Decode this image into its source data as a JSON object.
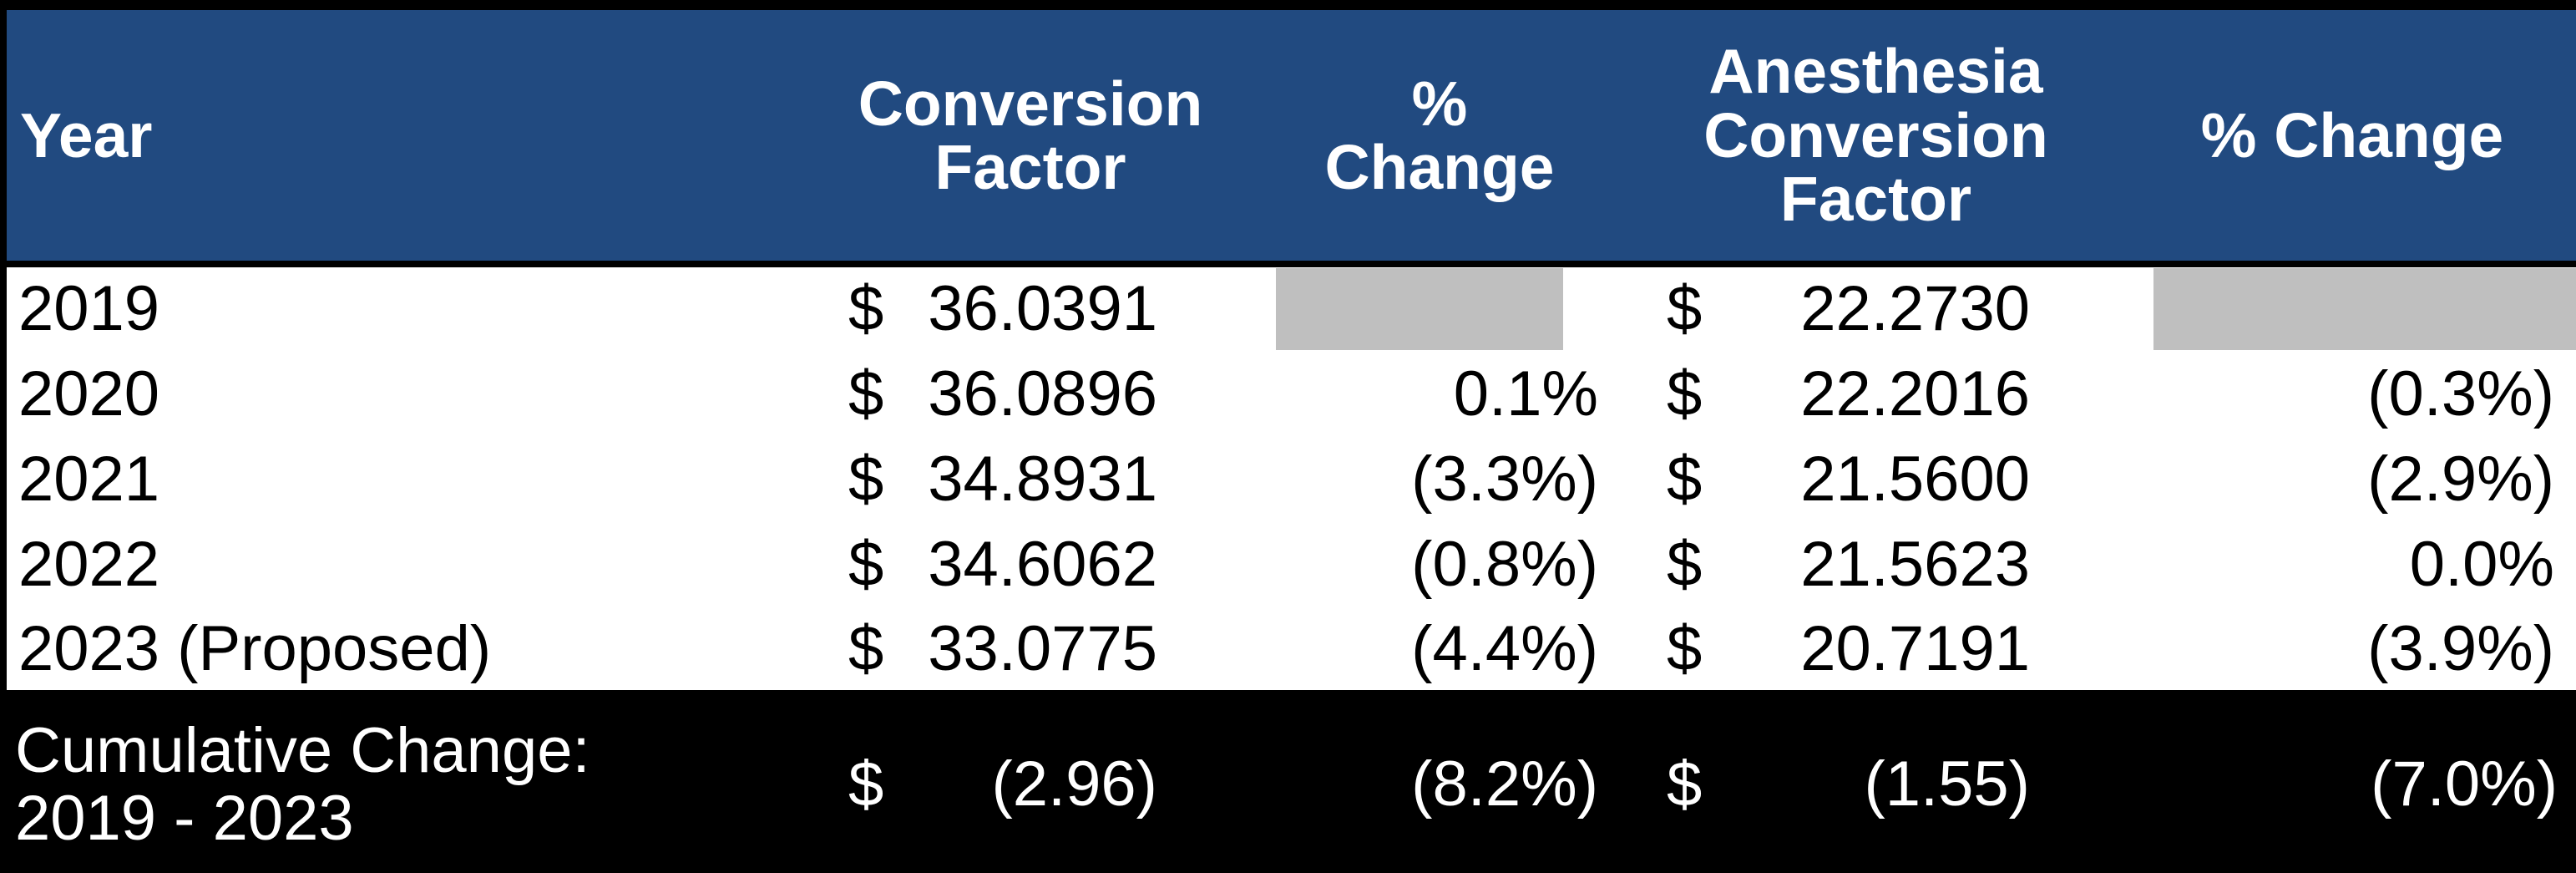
{
  "table": {
    "columns": [
      {
        "key": "year",
        "label": "Year"
      },
      {
        "key": "cf",
        "label": "Conversion Factor"
      },
      {
        "key": "cf_pct",
        "label": "% Change"
      },
      {
        "key": "anes_cf",
        "label": "Anesthesia Conversion Factor"
      },
      {
        "key": "anes_pct",
        "label": "% Change"
      }
    ],
    "header_lines": {
      "year": [
        "Year"
      ],
      "cf": [
        "Conversion",
        "Factor"
      ],
      "cf_pct": [
        "%",
        "Change"
      ],
      "anes_cf": [
        "Anesthesia",
        "Conversion",
        "Factor"
      ],
      "anes_pct": [
        "% Change"
      ]
    },
    "currency_symbol": "$",
    "rows": [
      {
        "year": "2019",
        "cf": "36.0391",
        "cf_pct": "",
        "cf_pct_blank": true,
        "anes_cf": "22.2730",
        "anes_pct": "",
        "anes_pct_blank": true
      },
      {
        "year": "2020",
        "cf": "36.0896",
        "cf_pct": "0.1%",
        "cf_pct_blank": false,
        "anes_cf": "22.2016",
        "anes_pct": "(0.3%)",
        "anes_pct_blank": false
      },
      {
        "year": "2021",
        "cf": "34.8931",
        "cf_pct": "(3.3%)",
        "cf_pct_blank": false,
        "anes_cf": "21.5600",
        "anes_pct": "(2.9%)",
        "anes_pct_blank": false
      },
      {
        "year": "2022",
        "cf": "34.6062",
        "cf_pct": "(0.8%)",
        "cf_pct_blank": false,
        "anes_cf": "21.5623",
        "anes_pct": "0.0%",
        "anes_pct_blank": false
      },
      {
        "year": "2023 (Proposed)",
        "cf": "33.0775",
        "cf_pct": "(4.4%)",
        "cf_pct_blank": false,
        "anes_cf": "20.7191",
        "anes_pct": "(3.9%)",
        "anes_pct_blank": false
      }
    ],
    "footer": {
      "label_line1": "Cumulative Change:",
      "label_line2": "2019 - 2023",
      "cf": "(2.96)",
      "cf_pct": "(8.2%)",
      "anes_cf": "(1.55)",
      "anes_pct": "(7.0%)"
    },
    "colors": {
      "header_blue": "#214A80",
      "header_text": "#FFFFFF",
      "body_bg": "#FFFFFF",
      "body_text": "#000000",
      "blank_gray": "#BFBFBF",
      "footer_bg": "#000000",
      "footer_text": "#FFFFFF",
      "border": "#000000"
    }
  }
}
